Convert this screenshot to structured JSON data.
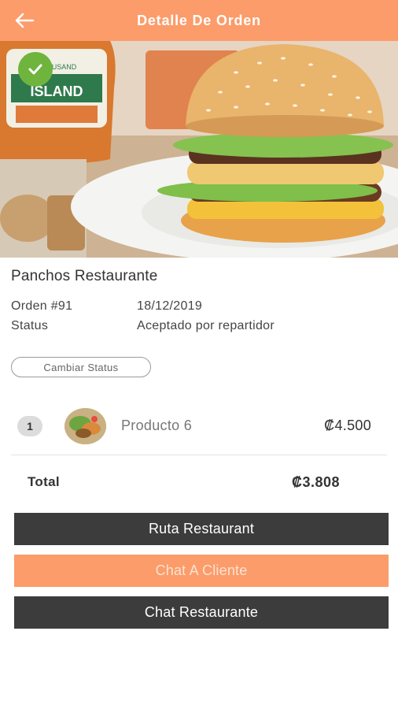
{
  "header": {
    "title": "Detalle De Orden",
    "back_icon": "arrow-left-icon"
  },
  "hero": {
    "badge_icon": "check-icon",
    "bottle_label_top": "THOUSAND",
    "bottle_label": "ISLAND"
  },
  "order": {
    "restaurant": "Panchos Restaurante",
    "order_label": "Orden #91",
    "date": "18/12/2019",
    "status_label": "Status",
    "status_value": "Aceptado por repartidor",
    "change_status_button": "Cambiar Status"
  },
  "items": [
    {
      "qty": "1",
      "name": "Producto 6",
      "price": "₡4.500"
    }
  ],
  "total": {
    "label": "Total",
    "value": "₡3.808"
  },
  "actions": {
    "route_button": "Ruta Restaurant",
    "chat_client_button": "Chat A Cliente",
    "chat_restaurant_button": "Chat Restaurante"
  },
  "colors": {
    "accent": "#fb9c6a",
    "dark_button": "#3c3c3c",
    "badge_green": "#6fb43d"
  }
}
